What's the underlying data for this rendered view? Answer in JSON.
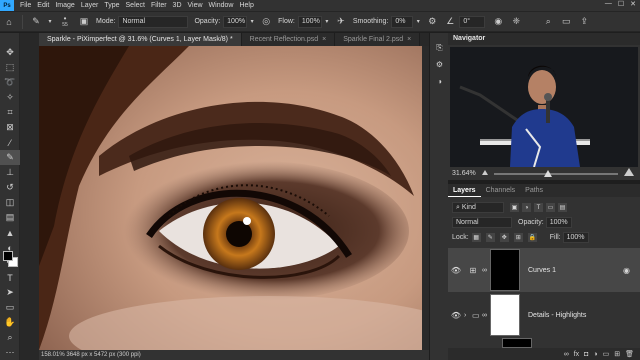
{
  "menu": {
    "items": [
      "File",
      "Edit",
      "Image",
      "Layer",
      "Type",
      "Select",
      "Filter",
      "3D",
      "View",
      "Window",
      "Help"
    ]
  },
  "options": {
    "brush_size": "55",
    "mode_label": "Mode:",
    "mode_value": "Normal",
    "opacity_label": "Opacity:",
    "opacity_value": "100%",
    "flow_label": "Flow:",
    "flow_value": "100%",
    "smoothing_label": "Smoothing:",
    "smoothing_value": "0%",
    "angle_value": "0°"
  },
  "tabs": [
    {
      "label": "Sparkle - PiXimperfect @ 31.6% (Curves 1, Layer Mask/8) *",
      "active": true
    },
    {
      "label": "Recent Reflection.psd",
      "active": false
    },
    {
      "label": "Sparkle Final 2.psd",
      "active": false
    }
  ],
  "status": {
    "text": "158.01%  3648 px x 5472 px (300 ppi)"
  },
  "navigator": {
    "title": "Navigator",
    "zoom": "31.64%"
  },
  "layers_panel": {
    "tabs": [
      "Layers",
      "Channels",
      "Paths"
    ],
    "kind_label": "Kind",
    "blend_mode": "Normal",
    "opacity_label": "Opacity:",
    "opacity_value": "100%",
    "lock_label": "Lock:",
    "fill_label": "Fill:",
    "fill_value": "100%",
    "layers": [
      {
        "name": "Curves 1",
        "selected": true
      },
      {
        "name": "Details - Highlights",
        "selected": false
      }
    ]
  },
  "colors": {
    "accent": "#31a8ff",
    "panel_bg": "#323232",
    "app_bg": "#1e1e1e"
  }
}
